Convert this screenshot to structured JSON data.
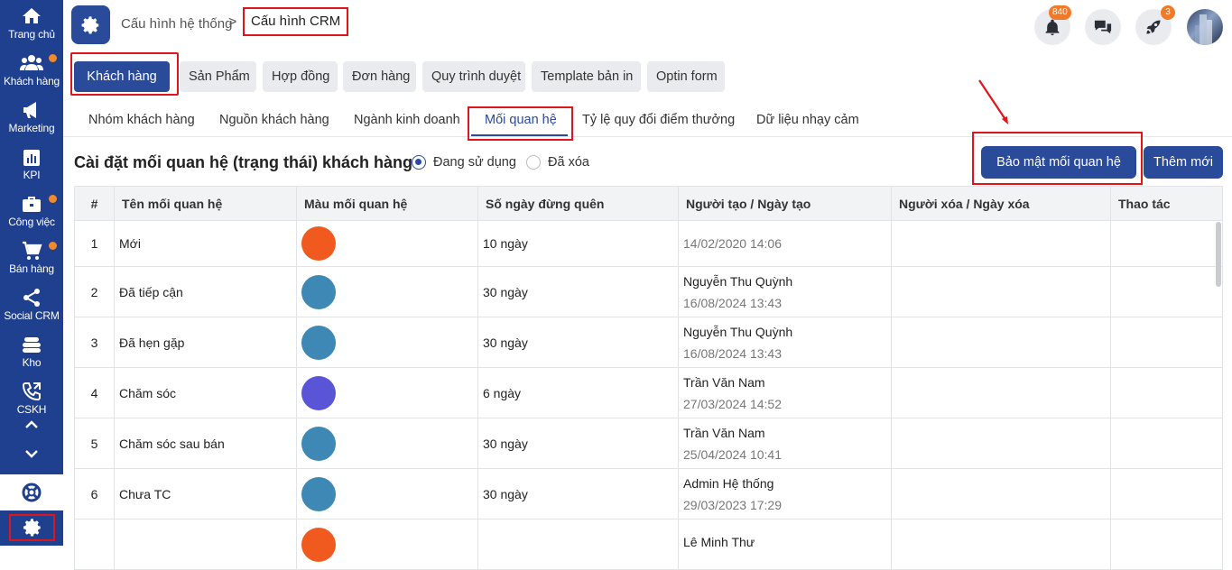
{
  "sidebar": {
    "items": [
      {
        "label": "Trang chủ",
        "icon": "home-icon"
      },
      {
        "label": "Khách hàng",
        "icon": "users-icon",
        "dot": true
      },
      {
        "label": "Marketing",
        "icon": "megaphone-icon"
      },
      {
        "label": "KPI",
        "icon": "chart-icon"
      },
      {
        "label": "Công việc",
        "icon": "briefcase-icon",
        "dot": true
      },
      {
        "label": "Bán hàng",
        "icon": "cart-icon",
        "dot": true
      },
      {
        "label": "Social CRM",
        "icon": "share-icon"
      },
      {
        "label": "Kho",
        "icon": "stack-icon"
      },
      {
        "label": "CSKH",
        "icon": "phone-icon"
      }
    ]
  },
  "header": {
    "breadcrumb_parent": "Cấu hình hệ thống",
    "breadcrumb_separator": ">",
    "breadcrumb_current": "Cấu hình CRM",
    "notification_count": "840",
    "rocket_count": "3"
  },
  "top_buttons": [
    "Khách hàng",
    "Sản Phẩm",
    "Hợp đồng",
    "Đơn hàng",
    "Quy trình duyệt",
    "Template bản in",
    "Optin form"
  ],
  "tabs": [
    "Nhóm khách hàng",
    "Nguồn khách hàng",
    "Ngành kinh doanh",
    "Mối quan hệ",
    "Tỷ lệ quy đổi điểm thưởng",
    "Dữ liệu nhạy cảm"
  ],
  "section": {
    "title": "Cài đặt mối quan hệ (trạng thái) khách hàng",
    "radio_active": "Đang sử dụng",
    "radio_deleted": "Đã xóa",
    "secure_button": "Bảo mật mối quan hệ",
    "add_button": "Thêm mới"
  },
  "table": {
    "headers": [
      "#",
      "Tên mối quan hệ",
      "Màu mối quan hệ",
      "Số ngày đừng quên",
      "Người tạo / Ngày tạo",
      "Người xóa / Ngày xóa",
      "Thao tác"
    ],
    "rows": [
      {
        "num": "1",
        "name": "Mới",
        "color": "#f05a1e",
        "days": "10 ngày",
        "creator": "",
        "created": "14/02/2020 14:06"
      },
      {
        "num": "2",
        "name": "Đã tiếp cận",
        "color": "#3d88b5",
        "days": "30 ngày",
        "creator": "Nguyễn Thu Quỳnh",
        "created": "16/08/2024 13:43"
      },
      {
        "num": "3",
        "name": "Đã hẹn gặp",
        "color": "#3d88b5",
        "days": "30 ngày",
        "creator": "Nguyễn Thu Quỳnh",
        "created": "16/08/2024 13:43"
      },
      {
        "num": "4",
        "name": "Chăm sóc",
        "color": "#5a55d6",
        "days": "6 ngày",
        "creator": "Trần Văn Nam",
        "created": "27/03/2024 14:52"
      },
      {
        "num": "5",
        "name": "Chăm sóc sau bán",
        "color": "#3d88b5",
        "days": "30 ngày",
        "creator": "Trần Văn Nam",
        "created": "25/04/2024 10:41"
      },
      {
        "num": "6",
        "name": "Chưa TC",
        "color": "#3d88b5",
        "days": "30 ngày",
        "creator": "Admin Hệ thống",
        "created": "29/03/2023 17:29"
      },
      {
        "num": "",
        "name": "",
        "color": "#f05a1e",
        "days": "",
        "creator": "Lê Minh Thư",
        "created": ""
      }
    ]
  },
  "colors": {
    "sidebar": "#1f3f8f",
    "primary": "#2a4a9a",
    "highlight": "#e0141b",
    "badge": "#f07a2a"
  }
}
